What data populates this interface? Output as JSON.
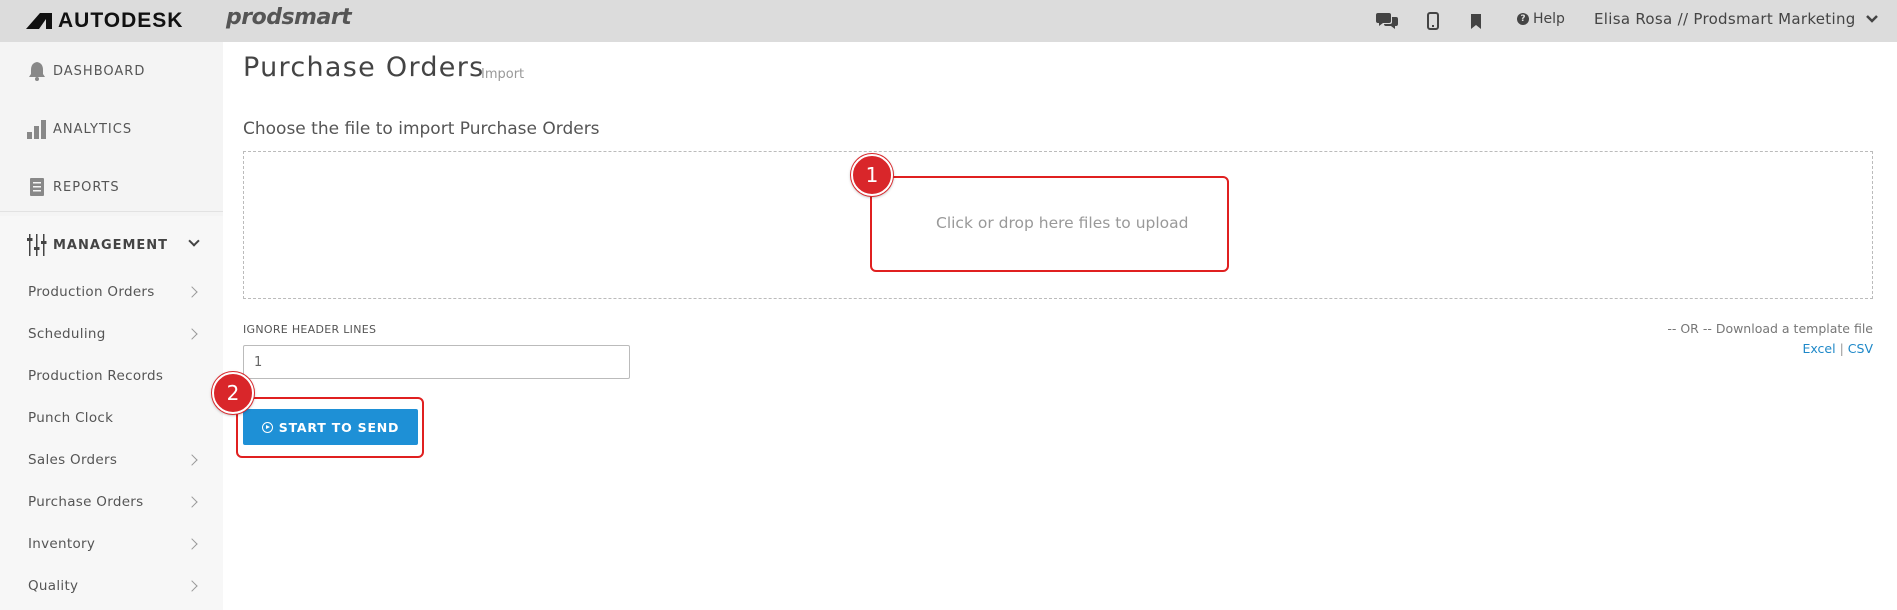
{
  "topbar": {
    "brand": "AUTODESK",
    "product": "prodsmart",
    "icons": [
      "chat-icon",
      "mobile-icon",
      "bookmark-icon"
    ],
    "help_label": "Help",
    "user_label": "Elisa Rosa // Prodsmart Marketing"
  },
  "sidebar": {
    "main_items": [
      {
        "label": "DASHBOARD",
        "icon": "bell-icon"
      },
      {
        "label": "ANALYTICS",
        "icon": "bar-chart-icon"
      },
      {
        "label": "REPORTS",
        "icon": "document-icon"
      },
      {
        "label": "MANAGEMENT",
        "icon": "sliders-icon",
        "expanded": true
      }
    ],
    "sub_items": [
      {
        "label": "Production Orders",
        "has_children": true
      },
      {
        "label": "Scheduling",
        "has_children": true
      },
      {
        "label": "Production Records",
        "has_children": false
      },
      {
        "label": "Punch Clock",
        "has_children": false
      },
      {
        "label": "Sales Orders",
        "has_children": true
      },
      {
        "label": "Purchase Orders",
        "has_children": true
      },
      {
        "label": "Inventory",
        "has_children": true
      },
      {
        "label": "Quality",
        "has_children": true
      }
    ]
  },
  "main": {
    "title": "Purchase Orders",
    "subtitle": "Import",
    "choose_label": "Choose the file to import Purchase Orders",
    "dropzone_text": "Click or drop here files to upload",
    "ignore_header_label": "IGNORE HEADER LINES",
    "ignore_header_value": "1",
    "template_text": "-- OR -- Download a template file",
    "template_excel": "Excel",
    "template_separator": "|",
    "template_csv": "CSV",
    "send_button": "START TO SEND"
  },
  "annotations": {
    "badge_1": "1",
    "badge_2": "2",
    "color": "#d9262a"
  },
  "colors": {
    "topbar_bg": "#dcdcdc",
    "sidebar_bg": "#f4f4f4",
    "accent_blue": "#1e90d6",
    "link_blue": "#1e88c8"
  }
}
